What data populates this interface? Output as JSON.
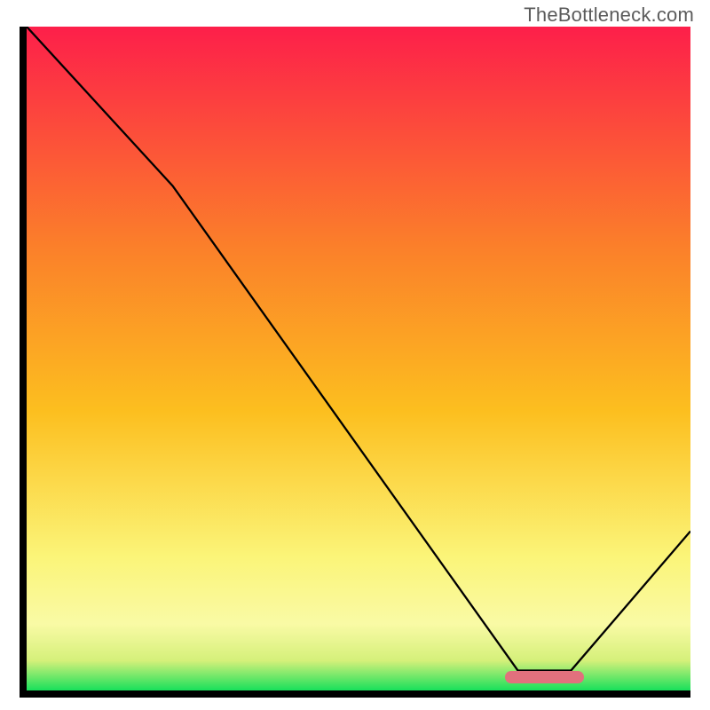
{
  "watermark": "TheBottleneck.com",
  "colors": {
    "top": "#fd1f4a",
    "mid": "#fcbf1f",
    "yellow_band": "#fcf88a",
    "green": "#18e05b",
    "marker": "#e2707d",
    "line": "#000000",
    "axis": "#000000"
  },
  "chart_data": {
    "type": "line",
    "title": "",
    "xlabel": "",
    "ylabel": "",
    "xlim": [
      0,
      100
    ],
    "ylim": [
      0,
      100
    ],
    "x": [
      0,
      22,
      74,
      82,
      100
    ],
    "y": [
      100,
      76,
      3,
      3,
      24
    ],
    "optimal_zone": {
      "x_start": 72,
      "x_end": 84,
      "y": 2
    },
    "gradient_stops": [
      {
        "offset": 0.0,
        "color": "#fd1f4a"
      },
      {
        "offset": 0.33,
        "color": "#fb7f2a"
      },
      {
        "offset": 0.58,
        "color": "#fcbf1f"
      },
      {
        "offset": 0.8,
        "color": "#fbf579"
      },
      {
        "offset": 0.9,
        "color": "#f9faa5"
      },
      {
        "offset": 0.955,
        "color": "#d5f07a"
      },
      {
        "offset": 1.0,
        "color": "#18e05b"
      }
    ]
  }
}
